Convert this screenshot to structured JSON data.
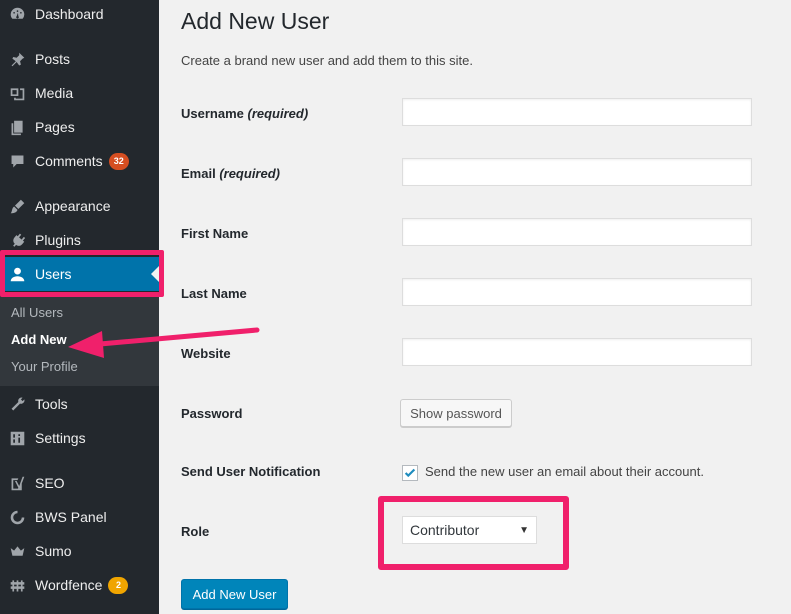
{
  "sidebar": {
    "items": [
      {
        "label": "Dashboard",
        "icon": "dashboard-icon"
      },
      {
        "label": "Posts",
        "icon": "pin-icon"
      },
      {
        "label": "Media",
        "icon": "media-icon"
      },
      {
        "label": "Pages",
        "icon": "pages-icon"
      },
      {
        "label": "Comments",
        "icon": "comment-icon",
        "badge": "32"
      },
      {
        "label": "Appearance",
        "icon": "brush-icon"
      },
      {
        "label": "Plugins",
        "icon": "plug-icon"
      },
      {
        "label": "Users",
        "icon": "user-icon"
      },
      {
        "label": "Tools",
        "icon": "wrench-icon"
      },
      {
        "label": "Settings",
        "icon": "sliders-icon"
      },
      {
        "label": "SEO",
        "icon": "yoast-icon"
      },
      {
        "label": "BWS Panel",
        "icon": "bws-icon"
      },
      {
        "label": "Sumo",
        "icon": "crown-icon"
      },
      {
        "label": "Wordfence",
        "icon": "wordfence-icon",
        "badge": "2"
      }
    ],
    "submenu": {
      "all_users": "All Users",
      "add_new": "Add New",
      "your_profile": "Your Profile"
    }
  },
  "page": {
    "title": "Add New User",
    "description": "Create a brand new user and add them to this site.",
    "fields": {
      "username_label": "Username",
      "username_req": "(required)",
      "email_label": "Email",
      "email_req": "(required)",
      "first_name_label": "First Name",
      "last_name_label": "Last Name",
      "website_label": "Website",
      "password_label": "Password",
      "notification_label": "Send User Notification",
      "role_label": "Role"
    },
    "show_password_button": "Show password",
    "notification_checkbox_text": "Send the new user an email about their account.",
    "notification_checked": true,
    "role_selected": "Contributor",
    "submit_button": "Add New User"
  },
  "colors": {
    "sidebar_bg": "#23282d",
    "active_blue": "#0073aa",
    "highlight_pink": "#f0206b",
    "primary_button": "#0085ba"
  }
}
